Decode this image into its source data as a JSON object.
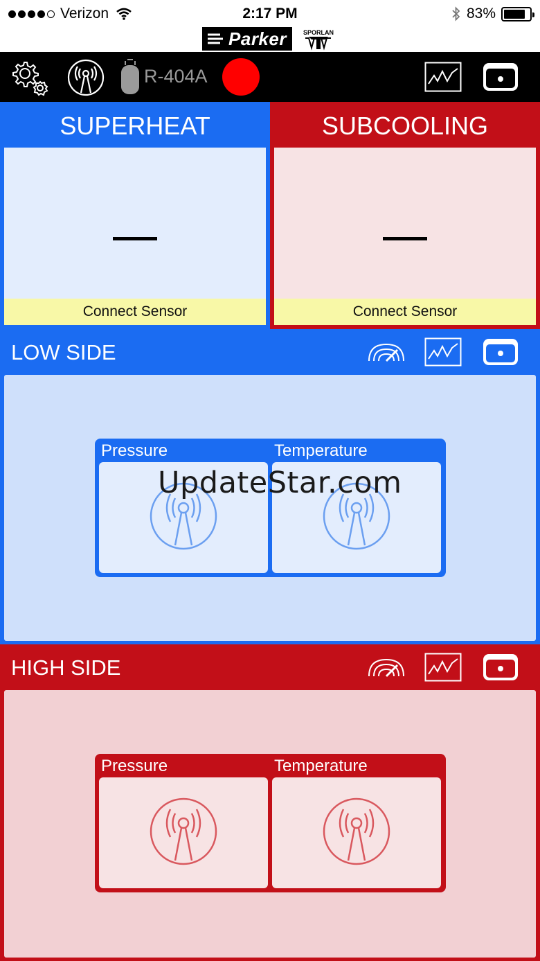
{
  "status": {
    "carrier": "Verizon",
    "time": "2:17 PM",
    "battery": "83%",
    "signal_bars": 4,
    "battery_level": 0.83
  },
  "brand": {
    "logo1": "Parker",
    "logo2": "SPORLAN"
  },
  "toolbar": {
    "refrigerant": "R-404A",
    "icons": [
      "settings-icon",
      "sensor-icon",
      "refrigerant-tank-icon",
      "record-indicator",
      "graph-icon",
      "device-icon"
    ]
  },
  "superheat": {
    "title": "SUPERHEAT",
    "value": "—",
    "status": "Connect Sensor"
  },
  "subcooling": {
    "title": "SUBCOOLING",
    "value": "—",
    "status": "Connect Sensor"
  },
  "low_side": {
    "title": "LOW SIDE",
    "pressure_label": "Pressure",
    "temperature_label": "Temperature"
  },
  "high_side": {
    "title": "HIGH SIDE",
    "pressure_label": "Pressure",
    "temperature_label": "Temperature"
  },
  "watermark": "UpdateStar.com",
  "colors": {
    "blue": "#1b6cf2",
    "red": "#c20f18",
    "record": "#ff0000",
    "connect_bar": "#f8f8a7"
  }
}
